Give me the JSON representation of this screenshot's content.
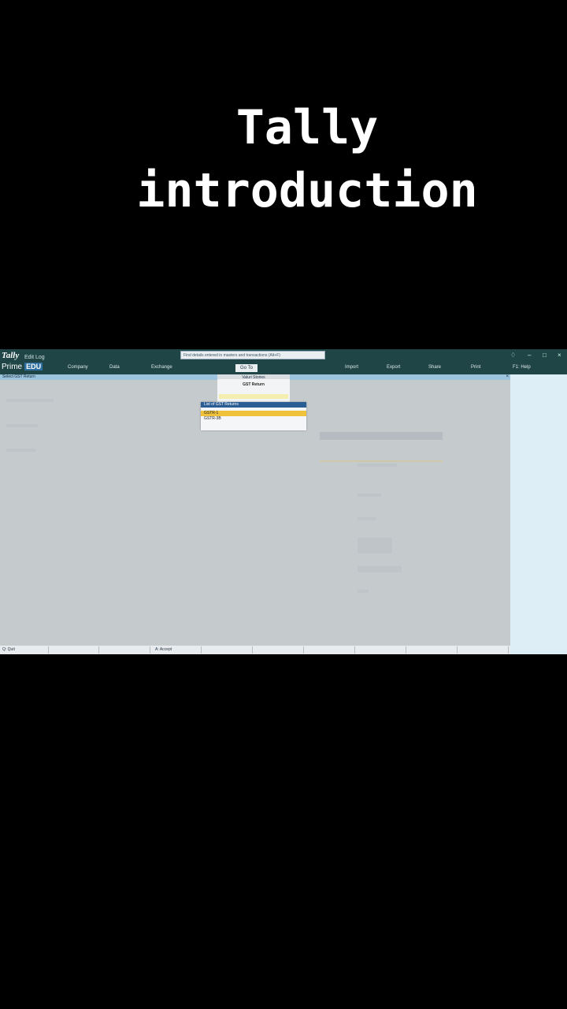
{
  "overlay": {
    "title_line1": "Tally",
    "title_line2": "introduction"
  },
  "app": {
    "logo": "Tally",
    "edit_log": "Edit Log",
    "product": "Prime",
    "edition": "EDU",
    "search_placeholder": "Find details entered in masters and transactions (Alt+F)",
    "menu": [
      "Company",
      "Data",
      "Exchange",
      "Go To",
      "Import",
      "Export",
      "Share",
      "Print",
      "F1: Help"
    ],
    "screen_title": "Select GST Return",
    "company": "Valuri Stories",
    "gst_return_label": "GST Return",
    "list": {
      "header": "List of GST Returns",
      "items": [
        "GSTR-1",
        "GSTR-3B"
      ],
      "selected_index": 0
    },
    "bottom": {
      "quit": "Q: Quit",
      "accept": "A: Accept"
    }
  }
}
